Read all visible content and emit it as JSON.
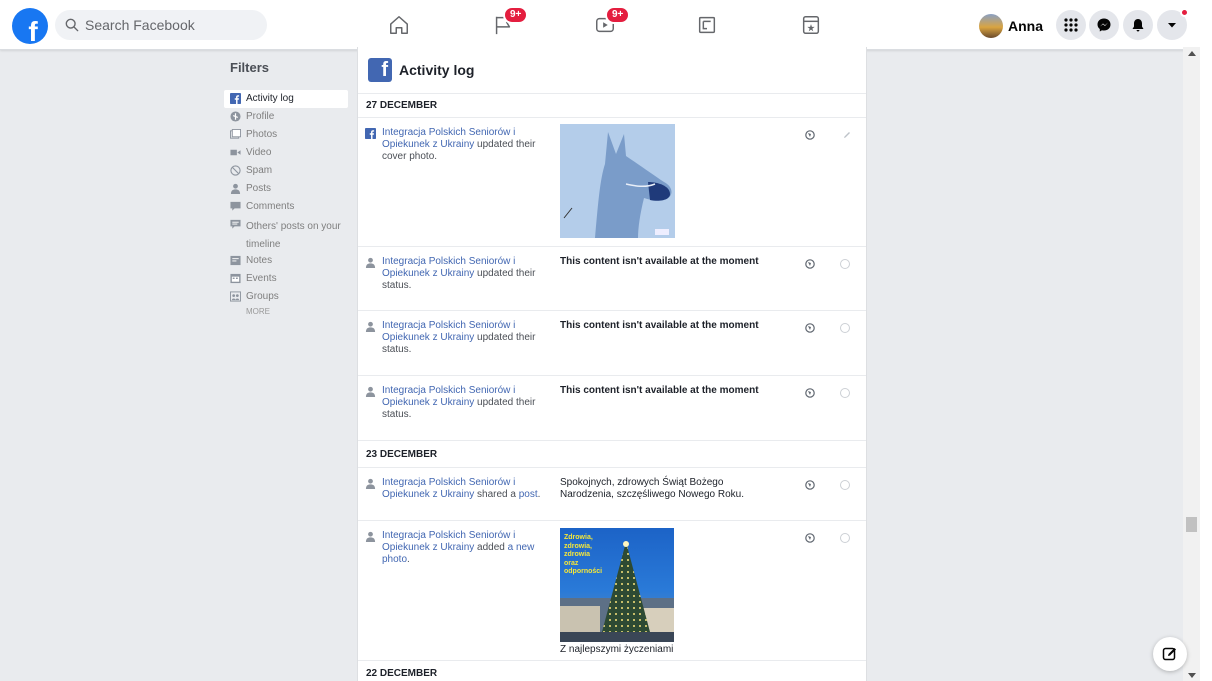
{
  "topbar": {
    "search_placeholder": "Search Facebook",
    "badges": {
      "pages": "9+",
      "watch": "9+"
    },
    "user_name": "Anna"
  },
  "filters": {
    "title": "Filters",
    "items": [
      {
        "label": "Activity log",
        "icon": "facebook-icon",
        "active": true
      },
      {
        "label": "Profile",
        "icon": "profile-icon"
      },
      {
        "label": "Photos",
        "icon": "photos-icon"
      },
      {
        "label": "Video",
        "icon": "video-icon"
      },
      {
        "label": "Spam",
        "icon": "spam-icon"
      },
      {
        "label": "Posts",
        "icon": "posts-icon"
      },
      {
        "label": "Comments",
        "icon": "comments-icon"
      },
      {
        "label": "Others' posts on your timeline",
        "icon": "others-posts-icon"
      },
      {
        "label": "Notes",
        "icon": "notes-icon"
      },
      {
        "label": "Events",
        "icon": "events-icon"
      },
      {
        "label": "Groups",
        "icon": "groups-icon"
      }
    ],
    "more": "MORE"
  },
  "main": {
    "title": "Activity log",
    "sections": [
      {
        "date": "27 DECEMBER",
        "entries": [
          {
            "actor": "Integracja Polskich Seniorów i Opiekunek z Ukrainy",
            "action": "updated their cover photo.",
            "content": "",
            "has_image": "dog"
          },
          {
            "actor": "Integracja Polskich Seniorów i Opiekunek z Ukrainy",
            "action": "updated their status.",
            "content": "This content isn't available at the moment"
          },
          {
            "actor": "Integracja Polskich Seniorów i Opiekunek z Ukrainy",
            "action": "updated their status.",
            "content": "This content isn't available at the moment"
          },
          {
            "actor": "Integracja Polskich Seniorów i Opiekunek z Ukrainy",
            "action": "updated their status.",
            "content": "This content isn't available at the moment"
          }
        ]
      },
      {
        "date": "23 DECEMBER",
        "entries": [
          {
            "actor": "Integracja Polskich Seniorów i Opiekunek z Ukrainy",
            "action": "shared a",
            "action_link": "post",
            "action_end": ".",
            "content": "Spokojnych, zdrowych Świąt Bożego Narodzenia, szczęśliwego Nowego Roku."
          },
          {
            "actor": "Integracja Polskich Seniorów i Opiekunek z Ukrainy",
            "action": "added",
            "action_link": "a new photo",
            "action_end": ".",
            "image_text": "Zdrowia, zdrowia, zdrowia oraz odporności",
            "caption": "Z najlepszymi życzeniami"
          }
        ]
      },
      {
        "date": "22 DECEMBER"
      }
    ]
  }
}
